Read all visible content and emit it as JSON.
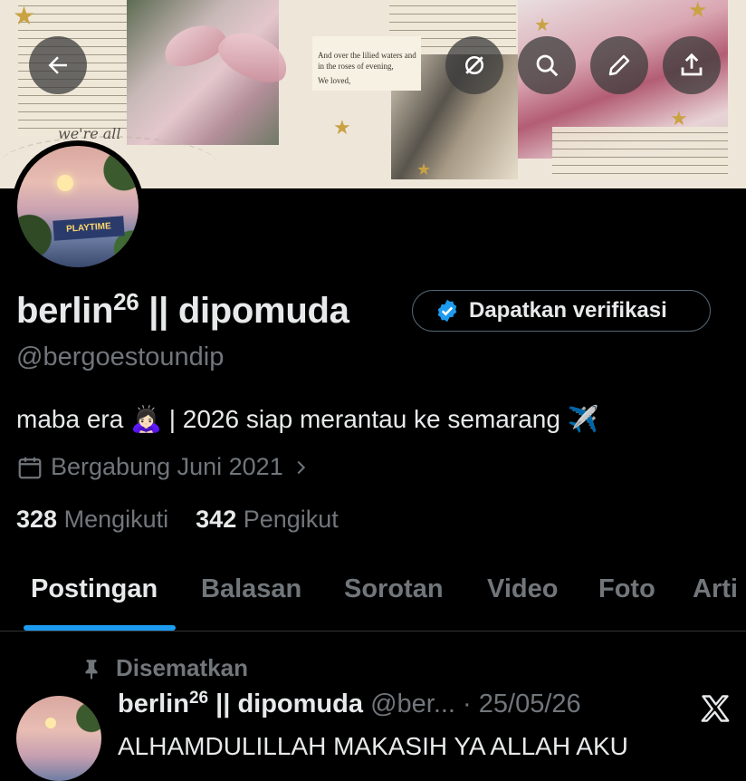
{
  "banner": {
    "script_text": "we're all",
    "book_lines": [
      "And over the lilied waters and",
      "in the roses of evening,",
      "We loved,"
    ]
  },
  "header_buttons": {
    "back_icon": "arrow-left-icon",
    "grok_icon": "grok-icon",
    "search_icon": "search-icon",
    "edit_icon": "pencil-icon",
    "share_icon": "share-upload-icon"
  },
  "profile": {
    "display_name_part1": "berlin",
    "display_name_sup": "26",
    "display_name_part2": " || dipomuda",
    "verify_button_label": "Dapatkan verifikasi",
    "handle": "@bergoestoundip",
    "bio": "maba era 🙇🏻‍♀️ | 2026 siap merantau ke semarang ✈️",
    "joined": "Bergabung Juni 2021",
    "following_count": "328",
    "following_label": "Mengikuti",
    "followers_count": "342",
    "followers_label": "Pengikut",
    "avatar_sign_text": "PLAYTIME"
  },
  "tabs": [
    {
      "label": "Postingan",
      "active": true
    },
    {
      "label": "Balasan"
    },
    {
      "label": "Sorotan"
    },
    {
      "label": "Video"
    },
    {
      "label": "Foto"
    },
    {
      "label": "Arti"
    }
  ],
  "pinned_tweet": {
    "pinned_label": "Disematkan",
    "name_part1": "berlin",
    "name_sup": "26",
    "name_part2": " || dipomuda",
    "handle": "@ber...",
    "separator": " · ",
    "date": "25/05/26",
    "body": "ALHAMDULILLAH MAKASIH YA ALLAH AKU"
  },
  "colors": {
    "accent": "#1d9bf0",
    "text_primary": "#e7e9ea",
    "text_secondary": "#71767b",
    "background": "#000000"
  }
}
